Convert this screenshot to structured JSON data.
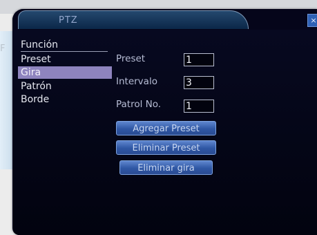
{
  "window": {
    "title": "PTZ",
    "close_glyph": "×"
  },
  "background": {
    "letter": "F"
  },
  "menu": {
    "header": "Función",
    "items": [
      {
        "label": "Preset",
        "selected": false
      },
      {
        "label": "Gira",
        "selected": true
      },
      {
        "label": "Patrón",
        "selected": false
      },
      {
        "label": "Borde",
        "selected": false
      }
    ]
  },
  "form": {
    "preset_label": "Preset",
    "preset_value": "1",
    "intervalo_label": "Intervalo",
    "intervalo_value": "3",
    "patrol_label": "Patrol No.",
    "patrol_value": "1"
  },
  "buttons": {
    "add_preset": "Agregar Preset",
    "delete_preset": "Eliminar Preset",
    "delete_tour": "Eliminar gira"
  },
  "colors": {
    "selection": "#8e84be",
    "button": "#3a64b5",
    "panel": "#04041c"
  }
}
